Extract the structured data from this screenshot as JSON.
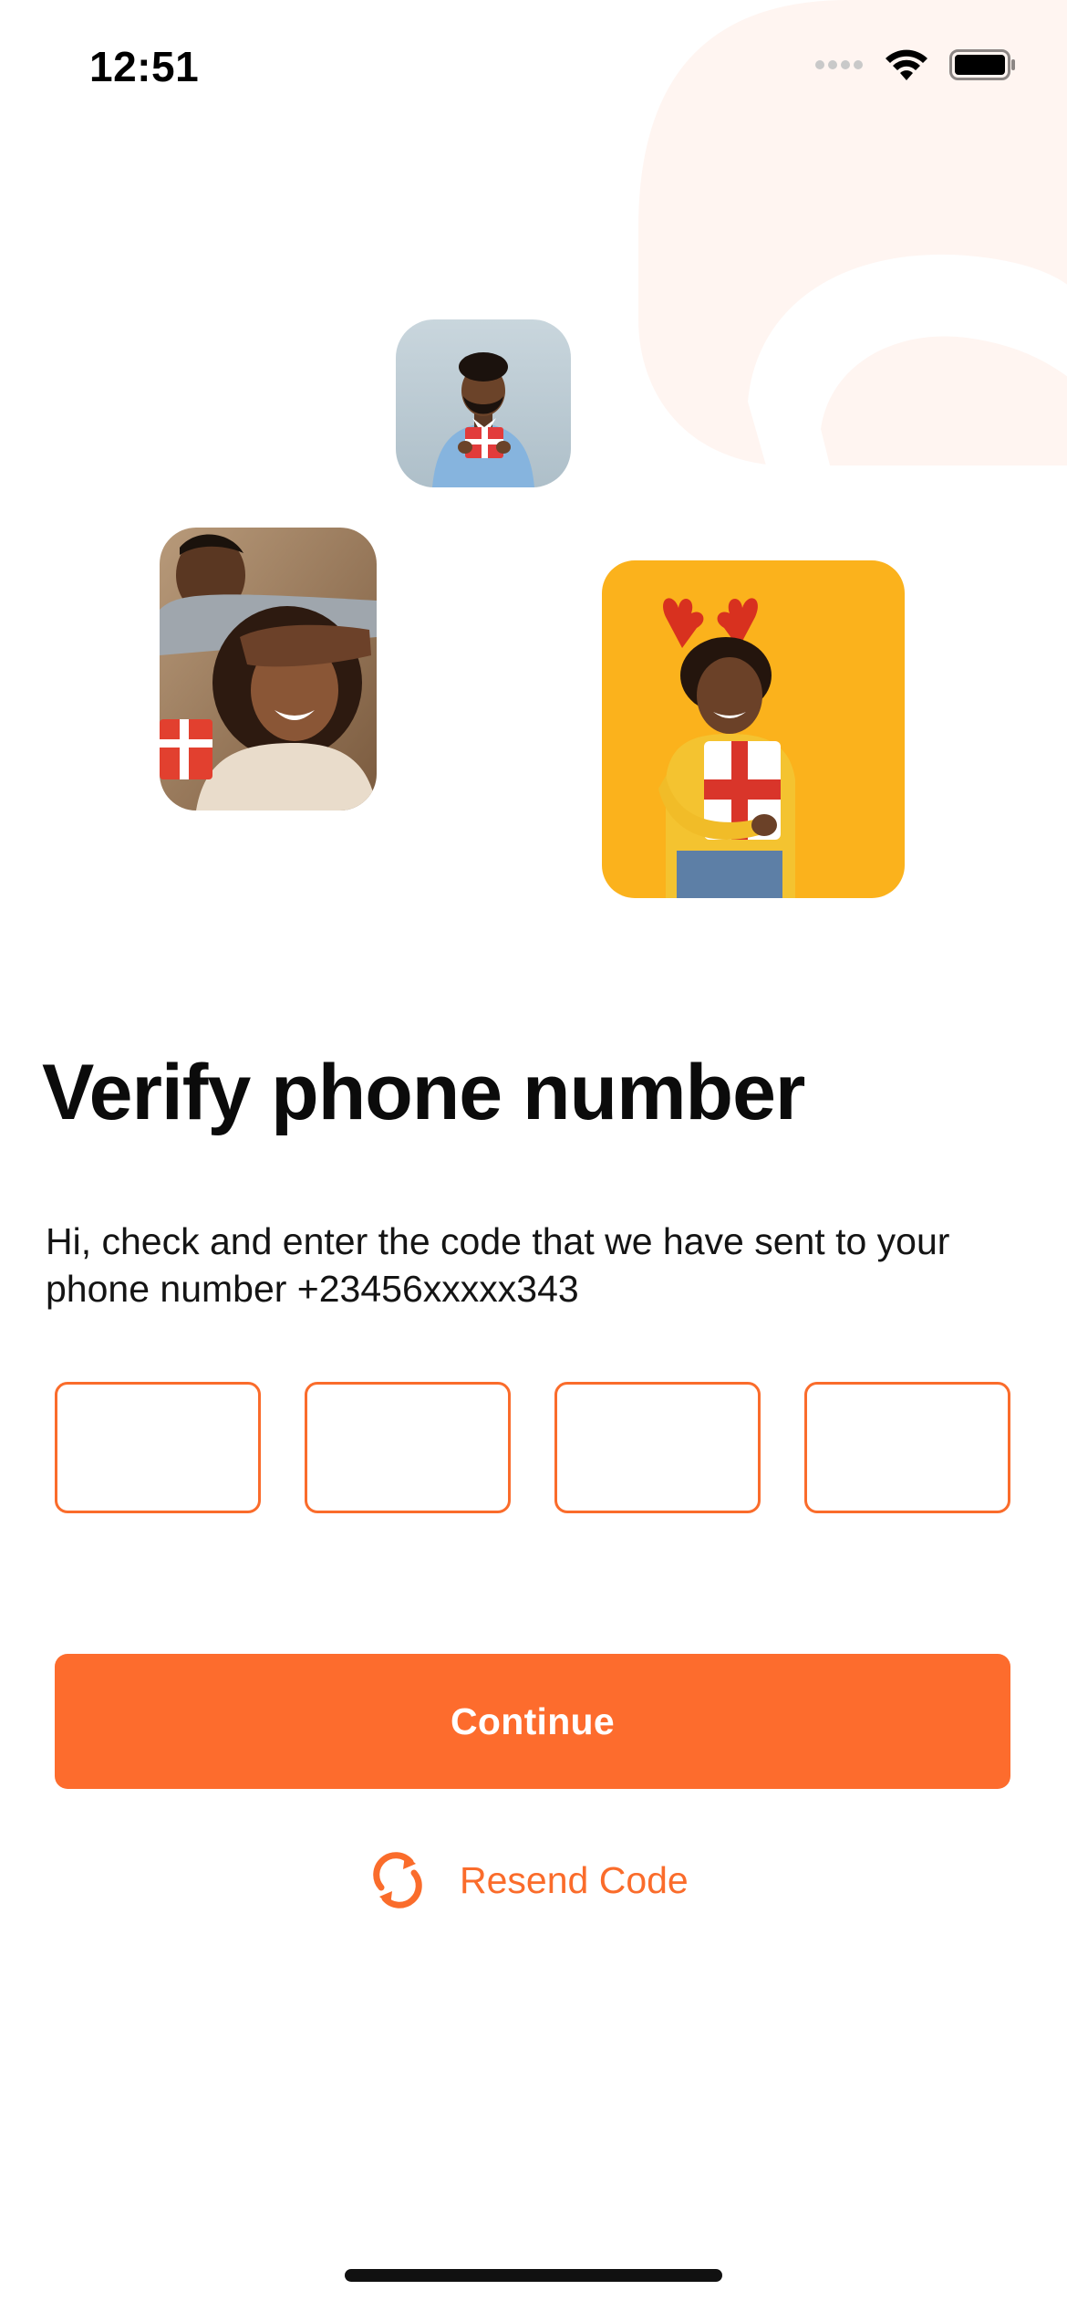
{
  "status_bar": {
    "time": "12:51"
  },
  "verify": {
    "title": "Verify phone number",
    "description": "Hi, check and enter the code that we have sent to your phone number +23456xxxxx343"
  },
  "otp": {
    "digits": [
      "",
      "",
      "",
      ""
    ]
  },
  "actions": {
    "continue_label": "Continue",
    "resend_label": "Resend Code"
  },
  "icons": {
    "resend": "refresh-icon",
    "signal": "cellular-signal-icon",
    "wifi": "wifi-icon",
    "battery": "battery-icon"
  },
  "colors": {
    "accent": "#FD6C2D",
    "otp_border": "#FA6C2B",
    "blob": "#FFF6F2"
  }
}
